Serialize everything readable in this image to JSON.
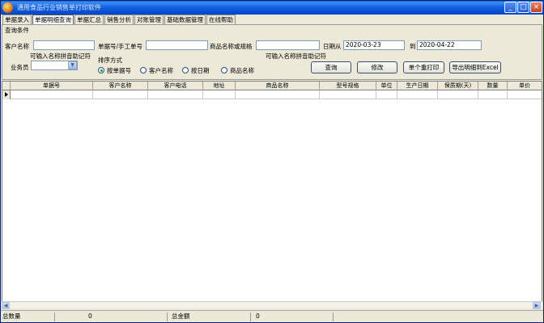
{
  "window": {
    "title": "通用食品行业销售单打印软件",
    "minimize": "_",
    "maximize": "□",
    "close": "×"
  },
  "tabs": [
    {
      "label": "单据录入"
    },
    {
      "label": "单据明细查询"
    },
    {
      "label": "单据汇总"
    },
    {
      "label": "销售分析"
    },
    {
      "label": "对账管理"
    },
    {
      "label": "基础数据管理"
    },
    {
      "label": "在线帮助"
    }
  ],
  "query": {
    "group_title": "查询条件",
    "customer_label": "客户名称",
    "customer_value": "",
    "customer_hint": "可输入名称拼音助记符",
    "order_label": "单据号/手工单号",
    "order_value": "",
    "product_label": "商品名称或规格",
    "product_value": "",
    "product_hint": "可输入名称拼音助记符",
    "date_from_label": "日期从",
    "date_from": "2020-03-23",
    "date_to_label": "到",
    "date_to": "2020-04-22",
    "salesman_label": "业务员",
    "salesman_value": "",
    "sort_label": "排序方式",
    "sort_options": [
      {
        "label": "按单据号",
        "checked": true
      },
      {
        "label": "客户名称",
        "checked": false
      },
      {
        "label": "按日期",
        "checked": false
      },
      {
        "label": "商品名称",
        "checked": false
      }
    ],
    "buttons": {
      "query": "查询",
      "edit": "修改",
      "reprint": "单个重打印",
      "export": "导出明细到Excel"
    }
  },
  "grid": {
    "columns": [
      "单据号",
      "客户名称",
      "客户电话",
      "地址",
      "商品名称",
      "型号规格",
      "单位",
      "生产日期",
      "保质期(天)",
      "数量",
      "单价"
    ]
  },
  "status": {
    "total_qty_label": "总数量",
    "total_qty": "0",
    "total_amount_label": "总金额",
    "total_amount": "0"
  }
}
